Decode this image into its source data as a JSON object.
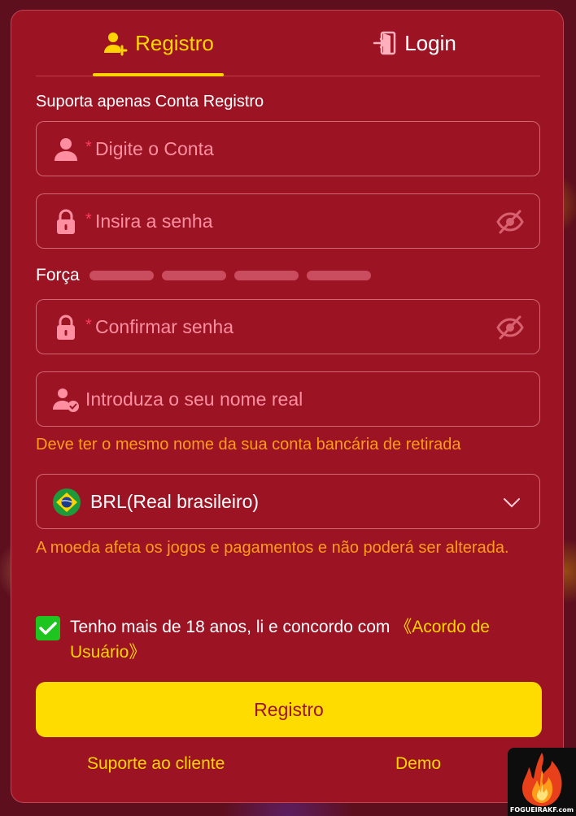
{
  "tabs": [
    {
      "label": "Registro",
      "icon": "user-add-icon",
      "active": true
    },
    {
      "label": "Login",
      "icon": "login-door-icon",
      "active": false
    }
  ],
  "form": {
    "hint": "Suporta apenas Conta Registro",
    "account": {
      "required_mark": "*",
      "placeholder": "Digite o Conta",
      "icon": "user-icon"
    },
    "password": {
      "required_mark": "*",
      "placeholder": "Insira a senha",
      "icon": "lock-icon"
    },
    "strength_label": "Força",
    "strength_level": 0,
    "confirm": {
      "required_mark": "*",
      "placeholder": "Confirmar senha",
      "icon": "lock-icon"
    },
    "realname": {
      "placeholder": "Introduza o seu nome real",
      "icon": "user-verified-icon"
    },
    "realname_note": "Deve ter o mesmo nome da sua conta bancária de retirada",
    "currency": {
      "value": "BRL(Real brasileiro)",
      "icon": "brazil-flag-icon"
    },
    "currency_note": "A moeda afeta os jogos e pagamentos e não poderá ser alterada.",
    "agreement": {
      "checked": true,
      "text": "Tenho mais de 18 anos, li e concordo com ",
      "link": "《Acordo de Usuário》"
    },
    "submit_label": "Registro"
  },
  "footer": {
    "support": "Suporte ao cliente",
    "demo": "Demo"
  },
  "badge": {
    "site": "FOGUEIRAKF.com"
  },
  "colors": {
    "panel": "#9c1424",
    "accent": "#ffd400",
    "placeholder": "#ff8fa0",
    "warning": "#ff9c1a",
    "checkbox": "#1ec51e"
  }
}
